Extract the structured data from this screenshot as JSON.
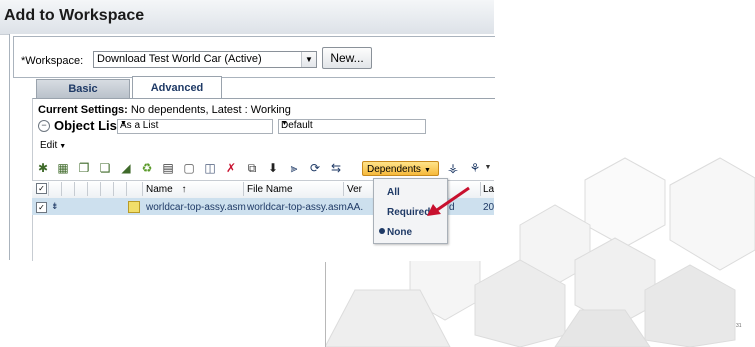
{
  "dialog": {
    "title": "Add to Workspace"
  },
  "workspace": {
    "label": "*Workspace:",
    "value": "Download Test World Car (Active)",
    "new_button": "New..."
  },
  "tabs": [
    {
      "label": "Basic"
    },
    {
      "label": "Advanced"
    }
  ],
  "settings": {
    "label": "Current Settings:",
    "value": "No dependents, Latest : Working"
  },
  "object_list": {
    "title": "Object List",
    "view_select": "As a List",
    "layout_select": "Default"
  },
  "edit_menu": {
    "label": "Edit"
  },
  "toolbar": {
    "dependents_button": "Dependents"
  },
  "columns": {
    "name": "Name",
    "sort_arrow": "↑",
    "file_name": "File Name",
    "version": "Ver",
    "last": "La"
  },
  "row": {
    "name": "worldcar-top-assy.asm",
    "file_name": "worldcar-top-assy.asm",
    "version": "AA.",
    "version_tail": "d",
    "last": "20"
  },
  "dependents_menu": {
    "items": [
      {
        "label": "All"
      },
      {
        "label": "Required"
      },
      {
        "label": "None",
        "selected": true
      }
    ]
  },
  "colors": {
    "accent": "#1f3a66",
    "dependents_button": "#f6b93c",
    "row_highlight": "#cde0ee",
    "arrow": "#c8102e"
  },
  "page_number": "31"
}
